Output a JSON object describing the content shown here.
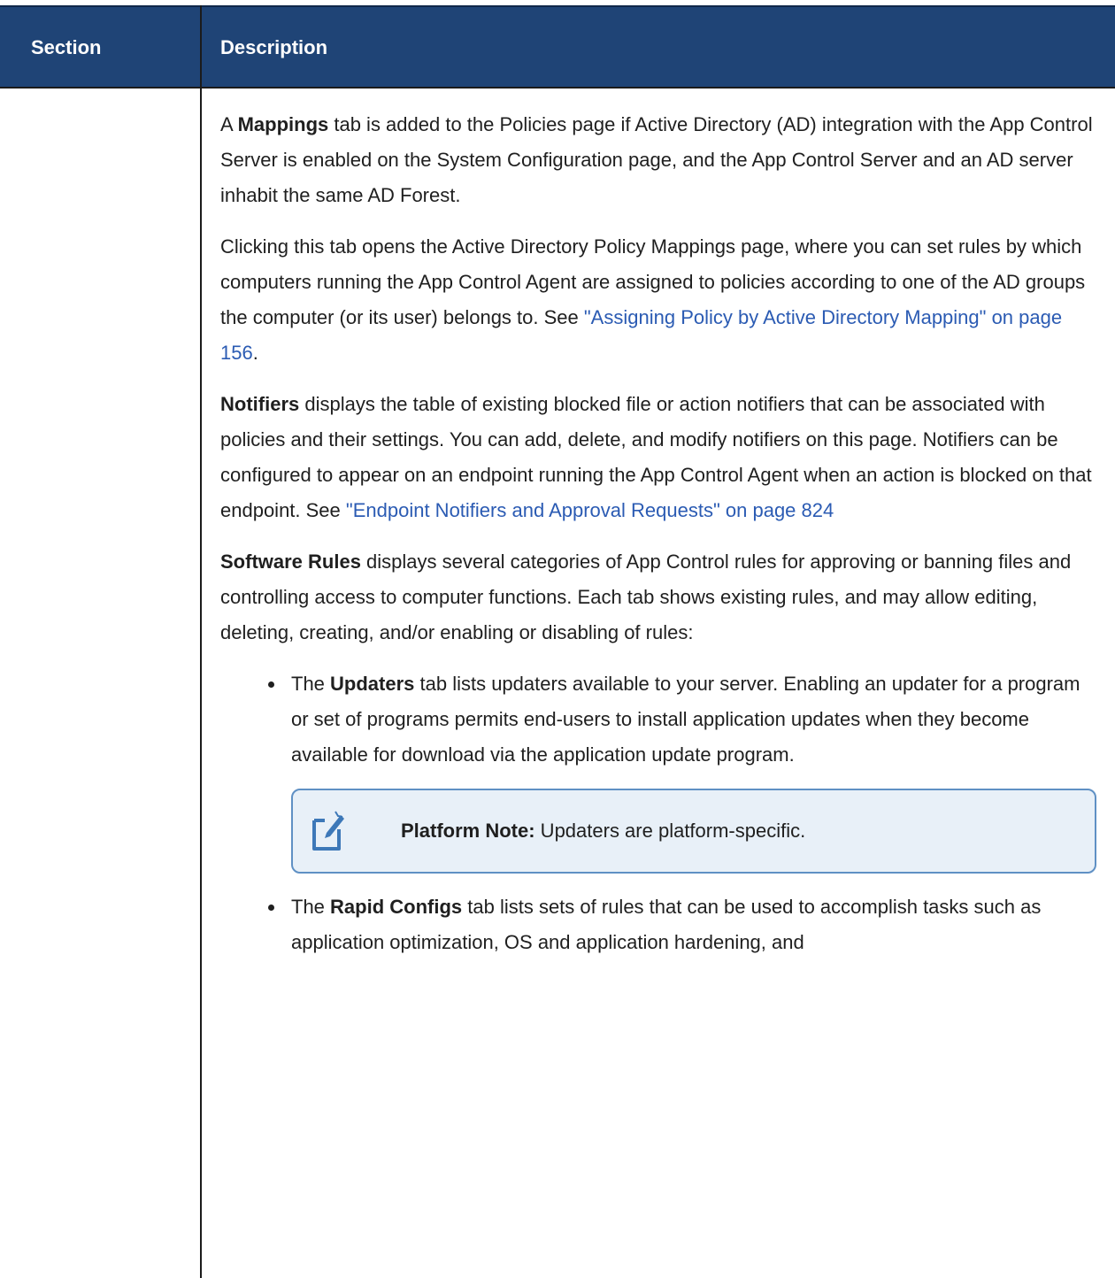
{
  "table_header": {
    "section": "Section",
    "description": "Description"
  },
  "paragraphs": {
    "p1": {
      "pre": "A ",
      "bold": "Mappings",
      "post": " tab is added to the Policies page if Active Directory (AD) integration with the App Control Server is enabled on the System Configuration page, and the App Control Server and an AD server inhabit the same AD Forest."
    },
    "p2": {
      "text": "Clicking this tab opens the Active Directory Policy Mappings page, where you can set rules by which computers running the App Control Agent are assigned to policies according to one of the AD groups the computer (or its user) belongs to. See ",
      "link": "\"Assigning Policy by Active Directory Mapping\" on page 156",
      "post": "."
    },
    "p3": {
      "bold": "Notifiers",
      "text": " displays the table of existing blocked file or action notifiers that can be associated with policies and their settings. You can add, delete, and modify notifiers on this page. Notifiers can be configured to appear on an endpoint running the App Control Agent when an action is blocked on that endpoint. See ",
      "link": "\"Endpoint Notifiers and Approval Requests\" on page 824"
    },
    "p4": {
      "bold": "Software Rules",
      "text": " displays several categories of App Control rules for approving or banning files and controlling access to computer functions. Each tab shows existing rules, and may allow editing, deleting, creating, and/or enabling or disabling of rules:"
    }
  },
  "bullets": [
    {
      "pre": "The ",
      "bold": "Updaters",
      "text": " tab lists updaters available to your server. Enabling an updater for a program or set of programs permits end-users to install application updates when they become available for download via the application update program."
    },
    {
      "pre": "The ",
      "bold": "Rapid Configs",
      "text": " tab lists sets of rules that can be used to accomplish tasks such as application optimization, OS and application hardening, and"
    }
  ],
  "note": {
    "icon": "note-edit-icon",
    "label": "Platform Note:",
    "text": " Updaters are platform-specific."
  },
  "colors": {
    "header_bg": "#1f4476",
    "link": "#2b5bb3",
    "note_border": "#5f90c4",
    "note_bg": "#e8f0f8"
  }
}
